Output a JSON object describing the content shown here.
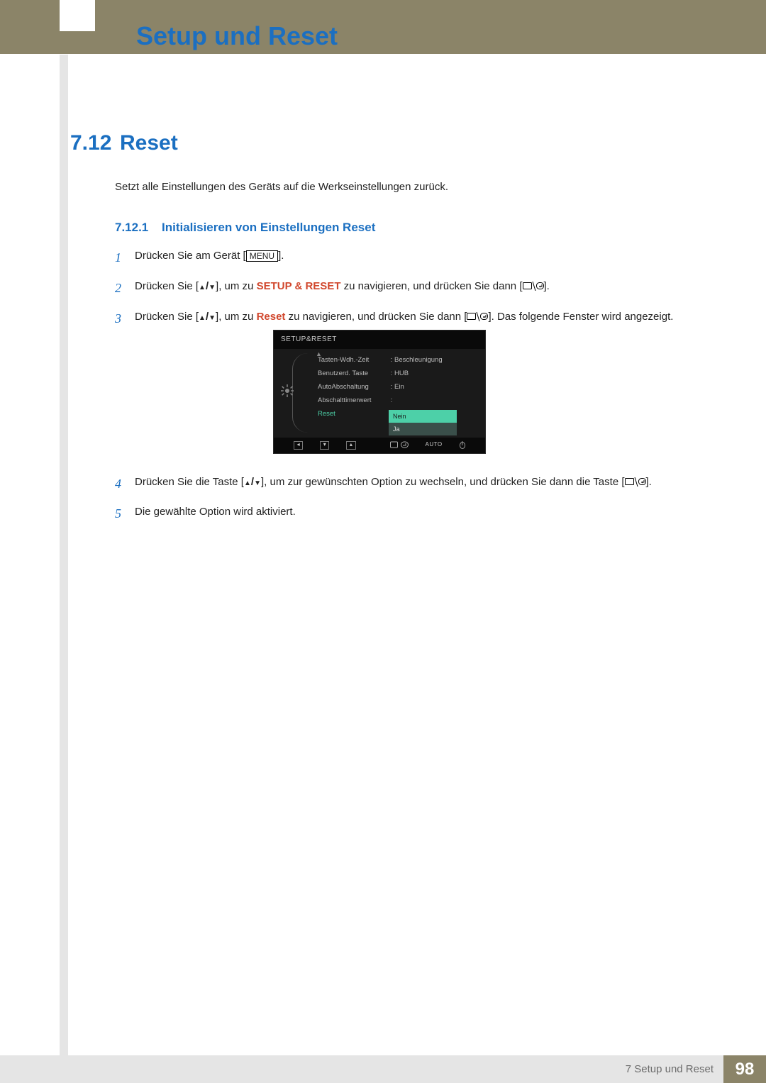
{
  "page_title": "Setup und Reset",
  "section": {
    "number": "7.12",
    "title": "Reset"
  },
  "intro": "Setzt alle Einstellungen des Geräts auf die Werkseinstellungen zurück.",
  "subsection": {
    "number": "7.12.1",
    "title": "Initialisieren von Einstellungen Reset"
  },
  "steps": {
    "s1_a": "Drücken Sie am Gerät [",
    "s1_menu": "MENU",
    "s1_b": "].",
    "s2_a": "Drücken Sie [",
    "s2_b": "], um zu ",
    "s2_setup": "SETUP & RESET",
    "s2_c": " zu navigieren, und drücken Sie dann [",
    "s2_d": "].",
    "s3_a": "Drücken Sie [",
    "s3_b": "], um zu ",
    "s3_reset": "Reset",
    "s3_c": " zu navigieren, und drücken Sie dann [",
    "s3_d": "]. Das folgende Fenster wird angezeigt.",
    "s4_a": "Drücken Sie die Taste [",
    "s4_b": "], um zur gewünschten Option zu wechseln, und drücken Sie dann die Taste [",
    "s4_c": "].",
    "s5": "Die gewählte Option wird aktiviert."
  },
  "osd": {
    "header": "SETUP&RESET",
    "rows": [
      {
        "label": "Tasten-Wdh.-Zeit",
        "value": "Beschleunigung"
      },
      {
        "label": "Benutzerd. Taste",
        "value": "HUB"
      },
      {
        "label": "AutoAbschaltung",
        "value": "Ein"
      },
      {
        "label": "Abschalttimerwert",
        "value": ""
      },
      {
        "label": "Reset",
        "value": ""
      }
    ],
    "dropdown": {
      "selected": "Nein",
      "other": "Ja"
    },
    "footer_auto": "AUTO"
  },
  "footer": {
    "chapter": "7 Setup und Reset",
    "page": "98"
  }
}
